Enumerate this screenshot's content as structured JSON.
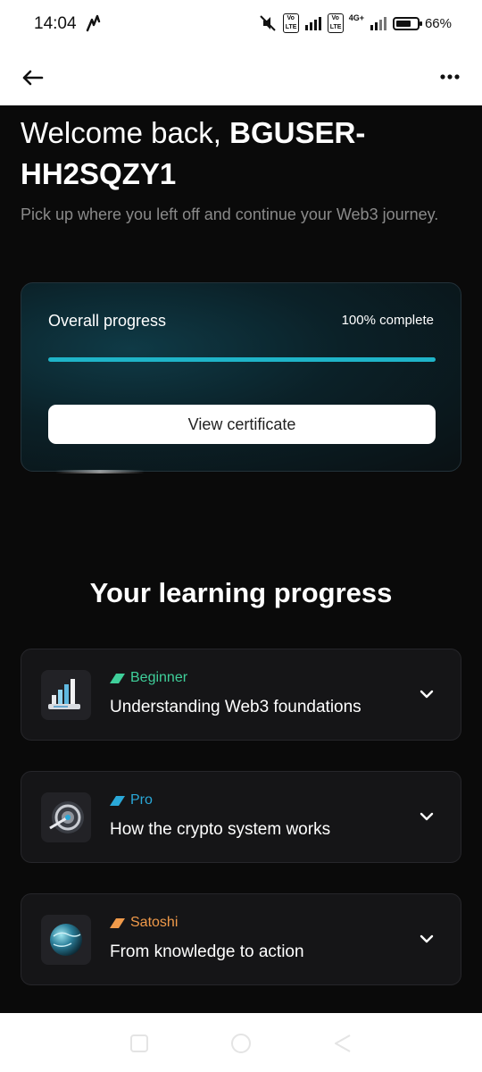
{
  "status_bar": {
    "time": "14:04",
    "battery": "66%",
    "network": "4G+",
    "volte_label": "Vo LTE"
  },
  "header": {
    "back_icon": "arrow-left-icon",
    "menu_icon": "more-horizontal-icon"
  },
  "welcome": {
    "greeting": "Welcome back,",
    "username": "BGUSER-HH2SQZY1",
    "subtitle": "Pick up where you left off and continue your Web3 journey."
  },
  "progress_card": {
    "label": "Overall progress",
    "percent_text": "100% complete",
    "progress_fraction": 1.0,
    "button_label": "View certificate",
    "accent_color": "#1fb4c8"
  },
  "learning": {
    "title": "Your learning progress",
    "courses": [
      {
        "level": "Beginner",
        "level_color": "#3fcf9a",
        "title": "Understanding Web3 foundations",
        "icon": "bar-chart-icon"
      },
      {
        "level": "Pro",
        "level_color": "#2aa8d8",
        "title": "How the crypto system works",
        "icon": "crypto-coin-icon"
      },
      {
        "level": "Satoshi",
        "level_color": "#f09a4a",
        "title": "From knowledge to action",
        "icon": "globe-icon"
      }
    ]
  }
}
